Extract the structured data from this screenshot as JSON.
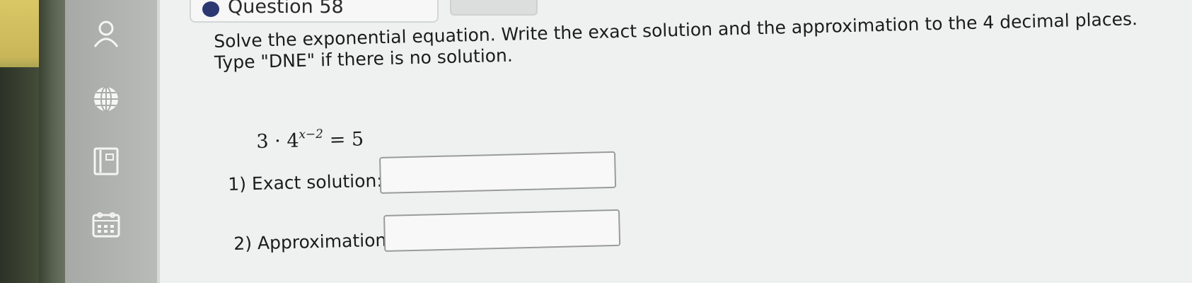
{
  "question": {
    "title": "Question 58"
  },
  "prompt": {
    "line1": "Solve the exponential equation. Write the exact solution and the approximation to the 4 decimal places.",
    "line2": "Type \"DNE\" if there is no solution."
  },
  "equation": {
    "base_coeff": "3 · 4",
    "exponent": "x−2",
    "rhs": " = 5"
  },
  "fields": [
    {
      "label": "1) Exact solution:",
      "value": ""
    },
    {
      "label": "2) Approximation:",
      "value": ""
    }
  ],
  "sidebar": {
    "icons": [
      "user-icon",
      "globe-icon",
      "book-icon",
      "calendar-icon"
    ]
  },
  "colors": {
    "dot": "#2b3872",
    "background": "#eff1f0"
  }
}
